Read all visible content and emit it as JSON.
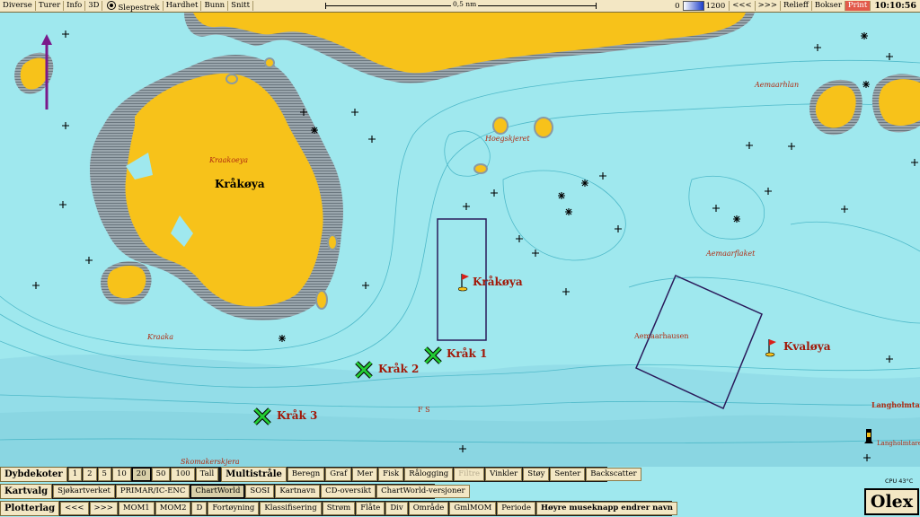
{
  "topbar": {
    "buttons": [
      "Diverse",
      "Turer",
      "Info",
      "3D",
      "Slepestrek",
      "Hardhet",
      "Bunn",
      "Snitt"
    ],
    "scale_label": "0,5 nm",
    "depth_min": "0",
    "depth_max": "1200",
    "nav_back": "<<<",
    "nav_fwd": ">>>",
    "relieff": "Relieff",
    "bokser": "Bokser",
    "print": "Print",
    "clock": "10:10:56"
  },
  "map": {
    "place_labels": {
      "kraakoeya_small": "Kraakoeya",
      "kraakoeya_big": "Kråkøya",
      "hoegskjeret": "Hoegskjeret",
      "aemaarhlan": "Aemaarhlan",
      "aemaarflaket": "Aemaarflaket",
      "aemaarhausen": "Aemaarhausen",
      "kraaka": "Kraaka",
      "skomakerskjera": "Skomakerskjera",
      "fs": "F S",
      "langholmtare": "Langholmtare",
      "langholmtaren": "Langholmtaren"
    },
    "flag_marks": [
      {
        "label": "Kråkøya"
      },
      {
        "label": "Kvaløya"
      }
    ],
    "x_marks": [
      {
        "label": "Kråk 1"
      },
      {
        "label": "Kråk 2"
      },
      {
        "label": "Kråk 3"
      }
    ],
    "colors": {
      "land": "#f7c21a",
      "shallow": "#8a9aa2",
      "water": "#9fe8ee",
      "mark_red": "#a11808",
      "x_green": "#22cc33",
      "box": "#2a1a5a"
    }
  },
  "panels": {
    "dybdekoter": {
      "title": "Dybdekoter",
      "values": [
        "1",
        "2",
        "5",
        "10",
        "20",
        "50",
        "100",
        "Tall"
      ],
      "selected": "20"
    },
    "multistraale": {
      "title": "Multistråle",
      "buttons": [
        "Beregn",
        "Graf",
        "Mer",
        "Fisk",
        "Rålogging",
        "Filtre",
        "Vinkler",
        "Støy",
        "Senter",
        "Backscatter"
      ]
    },
    "kartvalg": {
      "title": "Kartvalg",
      "buttons": [
        "Sjøkartverket",
        "PRIMAR/IC-ENC",
        "ChartWorld",
        "SOSI",
        "Kartnavn",
        "CD-oversikt",
        "ChartWorld-versjoner"
      ],
      "selected": "ChartWorld"
    },
    "plotterlag": {
      "title": "Plotterlag",
      "buttons": [
        "<<<",
        ">>>",
        "MOM1",
        "MOM2",
        "D",
        "Fortøyning",
        "Klassifisering",
        "Strøm",
        "Flåte",
        "Div",
        "Område",
        "GmlMOM",
        "Periode"
      ],
      "hint": "Høyre museknapp endrer navn"
    }
  },
  "status": {
    "cpu": "CPU 43°C",
    "logo": "Olex"
  }
}
